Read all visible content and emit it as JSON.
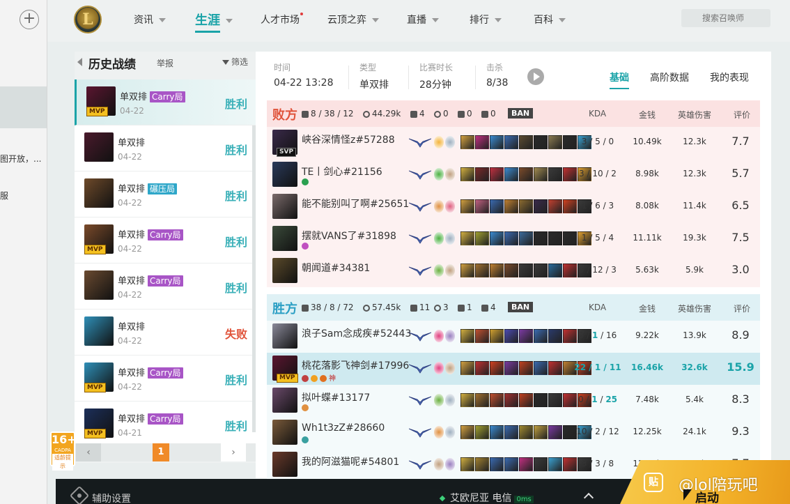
{
  "background_window": {
    "snippet_1": "图开放，...",
    "snippet_2": "服"
  },
  "nav": {
    "logo_letter": "L",
    "items": [
      {
        "label": "资讯",
        "caret": true,
        "active": false
      },
      {
        "label": "生涯",
        "caret": true,
        "active": true
      },
      {
        "label": "人才市场",
        "caret": false,
        "active": false,
        "dot": true
      },
      {
        "label": "云顶之弈",
        "caret": true,
        "active": false
      },
      {
        "label": "直播",
        "caret": true,
        "active": false
      },
      {
        "label": "排行",
        "caret": true,
        "active": false
      },
      {
        "label": "百科",
        "caret": true,
        "active": false
      }
    ],
    "search_placeholder": "搜索召唤师"
  },
  "history": {
    "title": "历史战绩",
    "report": "举报",
    "filter": "筛选",
    "matches": [
      {
        "mode": "单双排",
        "tag": "Carry局",
        "tag_type": "carry",
        "date": "04-22",
        "result": "胜利",
        "win": true,
        "mvp": "MVP",
        "selected": true,
        "color": "#5a1630"
      },
      {
        "mode": "单双排",
        "tag": "",
        "tag_type": "",
        "date": "04-22",
        "result": "胜利",
        "win": true,
        "mvp": "",
        "selected": false,
        "color": "#4a1a2c"
      },
      {
        "mode": "单双排",
        "tag": "碾压局",
        "tag_type": "press",
        "date": "04-22",
        "result": "胜利",
        "win": true,
        "mvp": "",
        "selected": false,
        "color": "#6e4a2a"
      },
      {
        "mode": "单双排",
        "tag": "Carry局",
        "tag_type": "carry",
        "date": "04-22",
        "result": "胜利",
        "win": true,
        "mvp": "MVP",
        "selected": false,
        "color": "#7a4a2a"
      },
      {
        "mode": "单双排",
        "tag": "Carry局",
        "tag_type": "carry",
        "date": "04-22",
        "result": "胜利",
        "win": true,
        "mvp": "",
        "selected": false,
        "color": "#6a4a30"
      },
      {
        "mode": "单双排",
        "tag": "",
        "tag_type": "",
        "date": "04-22",
        "result": "失败",
        "win": false,
        "mvp": "",
        "selected": false,
        "color": "#2f8fb8"
      },
      {
        "mode": "单双排",
        "tag": "Carry局",
        "tag_type": "carry",
        "date": "04-22",
        "result": "胜利",
        "win": true,
        "mvp": "MVP",
        "selected": false,
        "color": "#2f8fb8"
      },
      {
        "mode": "单双排",
        "tag": "Carry局",
        "tag_type": "carry",
        "date": "04-21",
        "result": "胜利",
        "win": true,
        "mvp": "MVP",
        "selected": false,
        "color": "#1c2f5a"
      }
    ],
    "page": "1",
    "prev": "‹",
    "next": "›"
  },
  "match": {
    "time_label": "时间",
    "time": "04-22 13:28",
    "type_label": "类型",
    "type": "单双排",
    "duration_label": "比赛时长",
    "duration": "28分钟",
    "kills_label": "击杀",
    "kills": "8/38",
    "tabs": [
      "基础",
      "高阶数据",
      "我的表现"
    ],
    "columns": {
      "kda": "KDA",
      "gold": "金钱",
      "damage": "英雄伤害",
      "score": "评价"
    },
    "ban_label": "BAN"
  },
  "teams": [
    {
      "name": "败方",
      "kda": "8 / 38 / 12",
      "gold": "44.29k",
      "towers": "4",
      "dragons": "0",
      "barons": "0",
      "heralds": "0",
      "players": [
        {
          "name": "峡谷深情怪z#57288",
          "badge": "SVP",
          "kda": "3 / 5 / 0",
          "gold": "10.49k",
          "damage": "12.3k",
          "score": "7.7",
          "color": "#3a2a4a",
          "spells": [
            "#f4b33a",
            "#9fb0c0"
          ],
          "items": [
            "#d2a040",
            "#c03080",
            "#3a8ad0",
            "#3a6ab0",
            "#5a4a30",
            "#2a2a2a",
            "#8a7a50",
            "#2a2a2a",
            "#3aa0d0"
          ]
        },
        {
          "name": "TE丨剑心#21156",
          "badge_icons": [
            "#2aa050"
          ],
          "kda": "3 / 10 / 2",
          "gold": "8.98k",
          "damage": "12.3k",
          "score": "5.7",
          "color": "#2a3a5a",
          "spells": [
            "#4ab040",
            "#c0a080"
          ],
          "items": [
            "#d2b040",
            "#7a2a2a",
            "#c03040",
            "#3a8ad0",
            "#7a4a2a",
            "#a08a50",
            "#3a3a3a",
            "#c03030",
            "#e0a030"
          ]
        },
        {
          "name": "能不能别叫了啊#25651",
          "kda": "1 / 6 / 3",
          "gold": "8.08k",
          "damage": "11.4k",
          "score": "6.5",
          "color": "#7a6a6a",
          "spells": [
            "#e09040",
            "#e06080"
          ],
          "items": [
            "#d2a040",
            "#c06080",
            "#3a6ab0",
            "#c08030",
            "#8a6a30",
            "#3a2a4a",
            "#c04030",
            "#d04020",
            "#3a3a3a"
          ]
        },
        {
          "name": "摆就VANS了#31898",
          "badge_icons": [
            "#c050c0"
          ],
          "kda": "1 / 5 / 4",
          "gold": "11.11k",
          "damage": "19.3k",
          "score": "7.5",
          "color": "#3a4a3a",
          "spells": [
            "#4ab040",
            "#9fb0c0"
          ],
          "items": [
            "#d2b040",
            "#a0a030",
            "#3a8ad0",
            "#3a6ab0",
            "#3a6a9a",
            "#2a2a2a",
            "#2a2a2a",
            "#2a2a2a",
            "#e0a030"
          ]
        },
        {
          "name": "朝闻道#34381",
          "kda": "0 / 12 / 3",
          "gold": "5.63k",
          "damage": "5.9k",
          "score": "3.0",
          "color": "#5a4a2a",
          "spells": [
            "#6ab040",
            "#c0a080"
          ],
          "items": [
            "#d2a040",
            "#a07030",
            "#c08030",
            "#7a4a2a",
            "#3a3a3a",
            "#3a3a3a",
            "#2a6a9a",
            "#c03030",
            "#3a3a3a"
          ]
        }
      ]
    },
    {
      "name": "胜方",
      "kda": "38 / 8 / 72",
      "gold": "57.45k",
      "towers": "11",
      "dragons": "3",
      "barons": "1",
      "heralds": "4",
      "players": [
        {
          "name": "浪子Sam念成疾#52443",
          "kda": "3 / 1 / 16",
          "deaths": "1",
          "gold": "9.22k",
          "damage": "13.9k",
          "score": "8.9",
          "color": "#8a8a9a",
          "spells": [
            "#e04080",
            "#9a80c0"
          ],
          "items": [
            "#d2b040",
            "#c05030",
            "#d0a030",
            "#4a4ab0",
            "#7a3aa0",
            "#3a6ab0",
            "#2a3a6a",
            "#c03030",
            "#3a3a3a"
          ]
        },
        {
          "name": "桃花落影飞神剑#17996",
          "badge": "MVP",
          "badge_text": "神",
          "badge_icons": [
            "#c04040",
            "#f0a020",
            "#e07020"
          ],
          "kda": "22 / 1 / 11",
          "deaths": "1",
          "gold": "16.46k",
          "damage": "32.6k",
          "score": "15.9",
          "highlight": true,
          "color": "#5a1630",
          "spells": [
            "#e04080",
            "#c0a080"
          ],
          "items": [
            "#d2a040",
            "#c03030",
            "#d04020",
            "#7a3aa0",
            "#c04020",
            "#3a6ab0",
            "#c03030",
            "#c08030",
            "#d04020"
          ]
        },
        {
          "name": "拟叶蝶#13177",
          "badge_icons": [
            "#e09040"
          ],
          "kda": "0 / 1 / 25",
          "deaths": "1",
          "assists_hi": "25",
          "gold": "7.48k",
          "damage": "5.4k",
          "score": "8.3",
          "color": "#6a4a6a",
          "spells": [
            "#6ab040",
            "#9fb0c0"
          ],
          "items": [
            "#d2b040",
            "#a07030",
            "#c05030",
            "#a03030",
            "#c04020",
            "#2a2a2a",
            "#3a3a3a",
            "#c03030",
            "#d04020"
          ]
        },
        {
          "name": "Wh1t3zZ#28660",
          "badge_icons": [
            "#3aa0a0"
          ],
          "kda": "10 / 2 / 12",
          "gold": "12.25k",
          "damage": "24.1k",
          "score": "9.3",
          "color": "#7a5a3a",
          "spells": [
            "#e09040",
            "#9fb0c0"
          ],
          "items": [
            "#d2a040",
            "#a0a030",
            "#3a8ad0",
            "#3a6ab0",
            "#a08a30",
            "#c0a040",
            "#7a3aa0",
            "#2a2a2a",
            "#3aa0d0"
          ]
        },
        {
          "name": "我的阿滋猫呢#54801",
          "kda": "3 / 3 / 8",
          "gold": "12.04k",
          "damage": "15.5k",
          "score": "7.7",
          "color": "#6a3a2a",
          "spells": [
            "#c0a080",
            "#9a80c0"
          ],
          "items": [
            "#d2b040",
            "#a08030",
            "#3a6ab0",
            "#3a6ab0",
            "#c03080",
            "#3a3a3a",
            "#3aa0d0",
            "#c03030",
            "#3a3a3a"
          ]
        }
      ]
    }
  ],
  "age_badge": {
    "age": "16+",
    "org": "CADPA",
    "note": "适龄提示"
  },
  "bottom": {
    "assist": "辅助设置",
    "server": "艾欧尼亚 电信",
    "ping": "0ms",
    "watermark": "@lol陪玩吧",
    "watermark_icon": "贴",
    "start": "启动"
  },
  "colors": {
    "accent": "#1aa3a8",
    "lose": "#e0533a",
    "win": "#2b9fc4",
    "carry_tag": "#a855c6",
    "press_tag": "#2fa7c9",
    "start": "#f3b22a"
  }
}
